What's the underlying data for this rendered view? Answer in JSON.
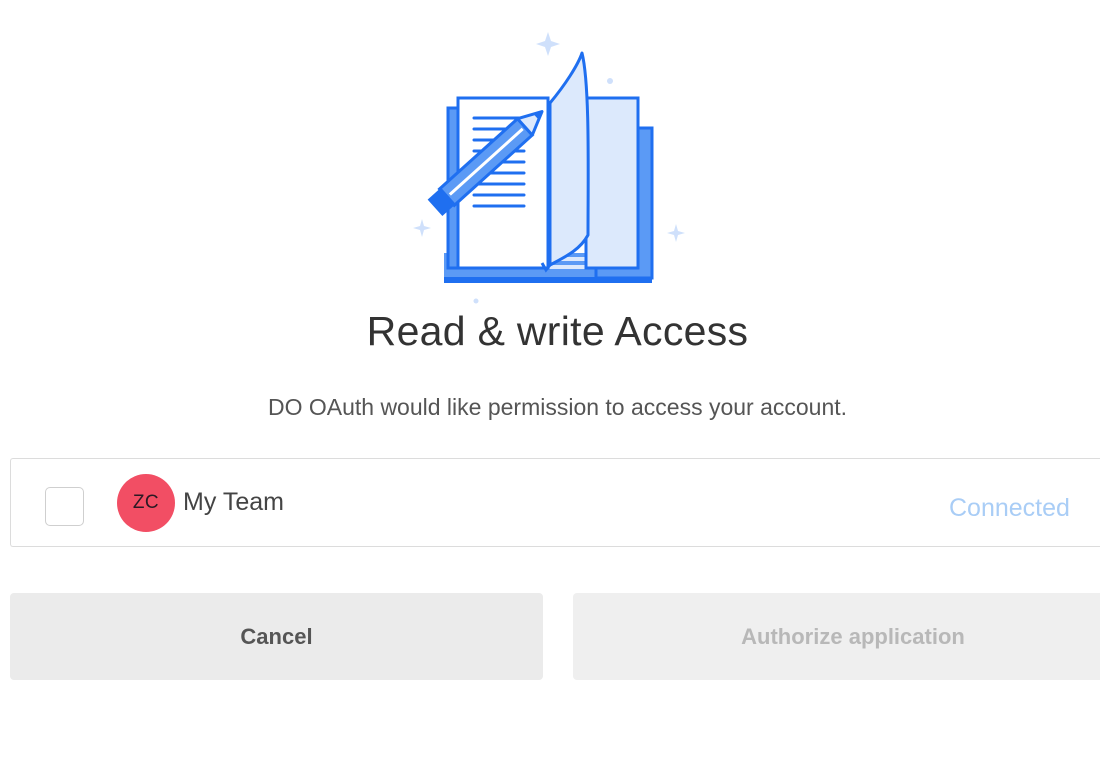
{
  "header": {
    "title": "Read & write Access",
    "subtitle": "DO OAuth would like permission to access your account."
  },
  "illustration": {
    "icon": "book-and-pencil-icon",
    "colors": {
      "primary": "#1f6ff0",
      "light": "#dce9fc",
      "mid": "#5b9af5",
      "sparkle": "#cfe0fb"
    }
  },
  "team": {
    "checked": false,
    "avatar_initials": "ZC",
    "avatar_color": "#f24e64",
    "name": "My Team",
    "status": "Connected"
  },
  "actions": {
    "cancel_label": "Cancel",
    "authorize_label": "Authorize application"
  }
}
